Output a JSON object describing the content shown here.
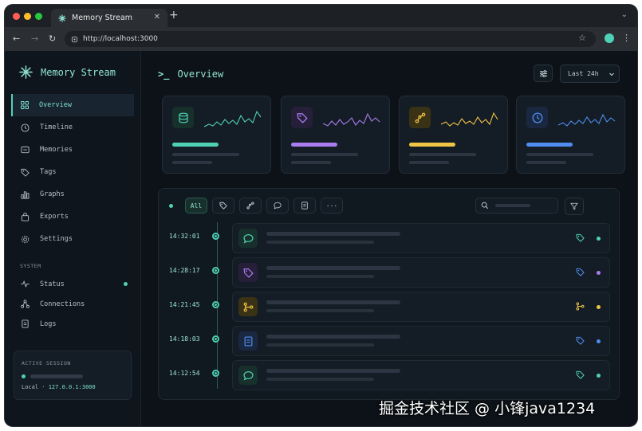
{
  "browser": {
    "tab_title": "Memory Stream",
    "url": "http://localhost:3000",
    "traffic_lights": [
      "#ff5f57",
      "#febc2e",
      "#28c840"
    ]
  },
  "sidebar": {
    "brand": "Memory Stream",
    "nav": [
      {
        "label": "Overview",
        "icon": "grid-icon",
        "active": true
      },
      {
        "label": "Timeline",
        "icon": "clock-icon"
      },
      {
        "label": "Memories",
        "icon": "message-icon"
      },
      {
        "label": "Tags",
        "icon": "tag-icon"
      },
      {
        "label": "Graphs",
        "icon": "bar-chart-icon"
      },
      {
        "label": "Exports",
        "icon": "bag-icon"
      },
      {
        "label": "Settings",
        "icon": "gear-icon"
      }
    ],
    "system_label": "SYSTEM",
    "system": [
      {
        "label": "Status",
        "icon": "pulse-icon"
      },
      {
        "label": "Connections",
        "icon": "nodes-icon"
      },
      {
        "label": "Logs",
        "icon": "document-icon"
      }
    ],
    "session": {
      "label": "ACTIVE SESSION",
      "host_prefix": "Local · ",
      "host_ip": "127.0.0.1:3000"
    }
  },
  "main": {
    "title": "Overview",
    "prompt": ">_",
    "range": "Last 24h"
  },
  "cards": [
    {
      "icon": "database-icon",
      "color": "#4fd1b5",
      "bg": "#17302c"
    },
    {
      "icon": "tag-icon",
      "color": "#a97cf0",
      "bg": "#261f3a"
    },
    {
      "icon": "graph-icon",
      "color": "#f0c445",
      "bg": "#3a3214"
    },
    {
      "icon": "clock-icon",
      "color": "#4f8ef0",
      "bg": "#1a2740"
    }
  ],
  "filters": {
    "all": "All",
    "more": "···",
    "chips": [
      "tag-icon",
      "graph-icon",
      "message-icon",
      "document-icon"
    ]
  },
  "events": [
    {
      "time": "14:32:01",
      "icon": "message-icon",
      "color": "#4fd1b5",
      "bg": "#17302c",
      "right_icon": "tag-icon"
    },
    {
      "time": "14:28:17",
      "icon": "tag-icon",
      "color": "#a97cf0",
      "bg": "#261f3a",
      "right_icon": "tag-icon"
    },
    {
      "time": "14:21:45",
      "icon": "graph-icon",
      "color": "#f0c445",
      "bg": "#3a3214",
      "right_icon": "graph-icon"
    },
    {
      "time": "14:18:03",
      "icon": "document-icon",
      "color": "#4f8ef0",
      "bg": "#1a2740",
      "right_icon": "tag-icon"
    },
    {
      "time": "14:12:54",
      "icon": "message-icon",
      "color": "#4fd1b5",
      "bg": "#17302c",
      "right_icon": "tag-icon"
    }
  ],
  "watermark": "掘金技术社区 @ 小锋java1234"
}
